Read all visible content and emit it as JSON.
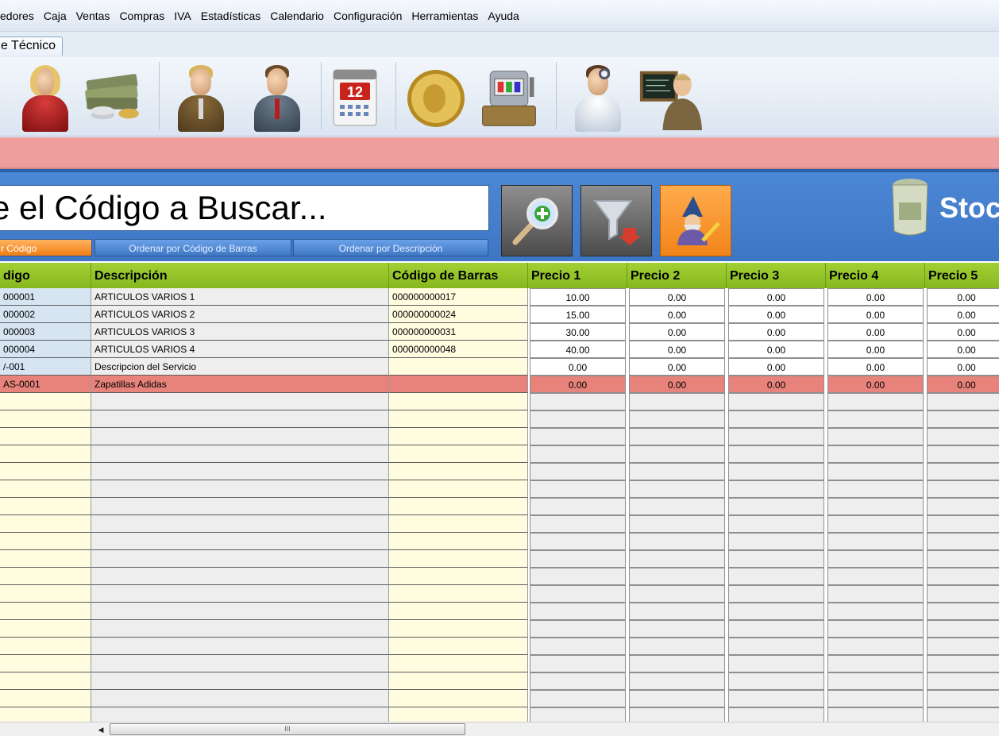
{
  "menu": [
    "edores",
    "Caja",
    "Ventas",
    "Compras",
    "IVA",
    "Estadísticas",
    "Calendario",
    "Configuración",
    "Herramientas",
    "Ayuda"
  ],
  "tab": "e Técnico",
  "toolbar": {
    "icons": [
      "client-icon",
      "money-icon",
      "seller-icon",
      "employee-icon",
      "calendar-icon",
      "coin-icon",
      "cash-register-icon",
      "technician-icon",
      "teacher-icon"
    ],
    "calendar_day": "12"
  },
  "search": {
    "value": "e el Código a Buscar...",
    "sort_buttons": [
      "r Código",
      "Ordenar por Código de Barras",
      "Ordenar por Descripción"
    ],
    "stock_label": "Stoc"
  },
  "colors": {
    "header_green": "#94c426",
    "selected_row": "#e7837b",
    "panel_blue": "#4680d0",
    "status_strip": "#ef9e9e"
  },
  "grid": {
    "columns": [
      "digo",
      "Descripción",
      "Código de Barras",
      "Precio 1",
      "Precio 2",
      "Precio 3",
      "Precio 4",
      "Precio 5"
    ],
    "rows": [
      {
        "code": "000001",
        "desc": "ARTICULOS VARIOS 1",
        "barcode": "000000000017",
        "p1": "10.00",
        "p2": "0.00",
        "p3": "0.00",
        "p4": "0.00",
        "p5": "0.00"
      },
      {
        "code": "000002",
        "desc": "ARTICULOS VARIOS 2",
        "barcode": "000000000024",
        "p1": "15.00",
        "p2": "0.00",
        "p3": "0.00",
        "p4": "0.00",
        "p5": "0.00"
      },
      {
        "code": "000003",
        "desc": "ARTICULOS VARIOS 3",
        "barcode": "000000000031",
        "p1": "30.00",
        "p2": "0.00",
        "p3": "0.00",
        "p4": "0.00",
        "p5": "0.00"
      },
      {
        "code": "000004",
        "desc": "ARTICULOS VARIOS 4",
        "barcode": "000000000048",
        "p1": "40.00",
        "p2": "0.00",
        "p3": "0.00",
        "p4": "0.00",
        "p5": "0.00"
      },
      {
        "code": "/-001",
        "desc": "Descripcion del Servicio",
        "barcode": "",
        "p1": "0.00",
        "p2": "0.00",
        "p3": "0.00",
        "p4": "0.00",
        "p5": "0.00"
      },
      {
        "code": "AS-0001",
        "desc": "Zapatillas Adidas",
        "barcode": "",
        "p1": "0.00",
        "p2": "0.00",
        "p3": "0.00",
        "p4": "0.00",
        "p5": "0.00",
        "selected": true
      }
    ]
  },
  "scrollbar": {
    "arrow": "◀",
    "grip": "III"
  }
}
